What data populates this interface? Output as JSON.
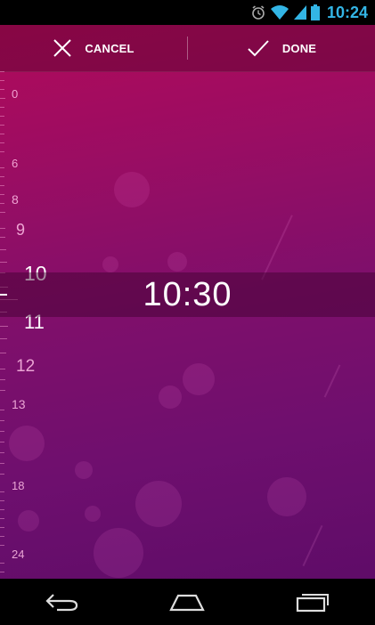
{
  "status_bar": {
    "time": "10:24",
    "icons": [
      "alarm-icon",
      "wifi-icon",
      "signal-icon",
      "battery-icon"
    ]
  },
  "action_bar": {
    "cancel_label": "CANCEL",
    "done_label": "DONE"
  },
  "ruler": {
    "hour_labels": [
      "0",
      "6",
      "8",
      "9",
      "10",
      "11",
      "12",
      "13",
      "18",
      "24"
    ]
  },
  "selected_time": "10:30",
  "nav_bar": {
    "icons": [
      "back-icon",
      "home-icon",
      "recent-apps-icon"
    ]
  },
  "colors": {
    "accent": "#33b5e5",
    "gradient_top": "#b10a5a",
    "gradient_bottom": "#5f0c68"
  }
}
